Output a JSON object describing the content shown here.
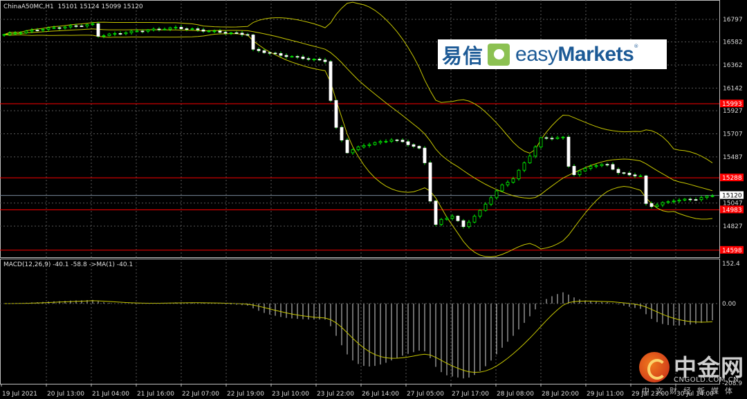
{
  "header": {
    "symbol": "ChinaA50MC,H1",
    "open": "15101",
    "high": "15124",
    "low": "15099",
    "close": "15120"
  },
  "macd_header": {
    "label": "MACD(12,26,9)",
    "main": "-40.1",
    "signal": "-58.8",
    "ma_label": "->MA(1)",
    "ma_value": "-40.1"
  },
  "logo": {
    "cn": "易信",
    "brand_light": "easy",
    "brand_bold": "Markets",
    "reg": "®"
  },
  "watermark": {
    "big": "中金网",
    "url": "CNGOLD.COM.CN",
    "sub": "中文财经新媒体"
  },
  "colors": {
    "background": "#000000",
    "bull": "#00ff00",
    "bear": "#ffffff",
    "bands": "#c8c800",
    "level": "#ff0000",
    "grid": "#5a5a5a",
    "axis": "#c0c0c0"
  },
  "chart_data": [
    {
      "type": "candlestick",
      "title": "ChinaA50MC,H1",
      "ylim": [
        14520,
        16960
      ],
      "price_ticks": [
        16797,
        16582,
        16362,
        16142,
        15927,
        15707,
        15487,
        15047,
        14827
      ],
      "levels": [
        15993,
        15288,
        14983,
        14598
      ],
      "current_price": 15120,
      "x_labels": [
        "19 Jul 2021",
        "20 Jul 13:00",
        "21 Jul 04:00",
        "21 Jul 16:00",
        "22 Jul 07:00",
        "22 Jul 19:00",
        "23 Jul 10:00",
        "23 Jul 22:00",
        "26 Jul 14:00",
        "27 Jul 05:00",
        "27 Jul 17:00",
        "28 Jul 08:00",
        "28 Jul 20:00",
        "29 Jul 11:00",
        "29 Jul 23:00",
        "30 Jul 14:00"
      ],
      "indicators": [
        "Bollinger Bands(20,2)"
      ],
      "close_keypoints": [
        [
          0,
          16652
        ],
        [
          7,
          16705
        ],
        [
          16,
          16750
        ],
        [
          17,
          16640
        ],
        [
          24,
          16685
        ],
        [
          31,
          16718
        ],
        [
          37,
          16685
        ],
        [
          44,
          16652
        ],
        [
          45,
          16507
        ],
        [
          50,
          16455
        ],
        [
          55,
          16420
        ],
        [
          58,
          16400
        ],
        [
          59,
          16026
        ],
        [
          60,
          15762
        ],
        [
          62,
          15532
        ],
        [
          65,
          15598
        ],
        [
          70,
          15651
        ],
        [
          72,
          15631
        ],
        [
          75,
          15565
        ],
        [
          76,
          15433
        ],
        [
          77,
          15071
        ],
        [
          78,
          14840
        ],
        [
          79,
          14887
        ],
        [
          81,
          14926
        ],
        [
          83,
          14821
        ],
        [
          86,
          14972
        ],
        [
          88,
          15104
        ],
        [
          90,
          15216
        ],
        [
          92,
          15282
        ],
        [
          95,
          15500
        ],
        [
          97,
          15664
        ],
        [
          101,
          15670
        ],
        [
          102,
          15401
        ],
        [
          103,
          15322
        ],
        [
          106,
          15401
        ],
        [
          109,
          15414
        ],
        [
          111,
          15335
        ],
        [
          115,
          15302
        ],
        [
          116,
          15039
        ],
        [
          117,
          15019
        ],
        [
          121,
          15072
        ],
        [
          125,
          15085
        ],
        [
          128,
          15120
        ]
      ]
    },
    {
      "type": "histogram+line",
      "title": "MACD(12,26,9)",
      "ylim": [
        -208.9,
        152.4
      ],
      "ticks": [
        "152.4",
        "0.00",
        "-208.9"
      ],
      "last": {
        "main": -40.1,
        "signal": -58.8
      }
    }
  ]
}
